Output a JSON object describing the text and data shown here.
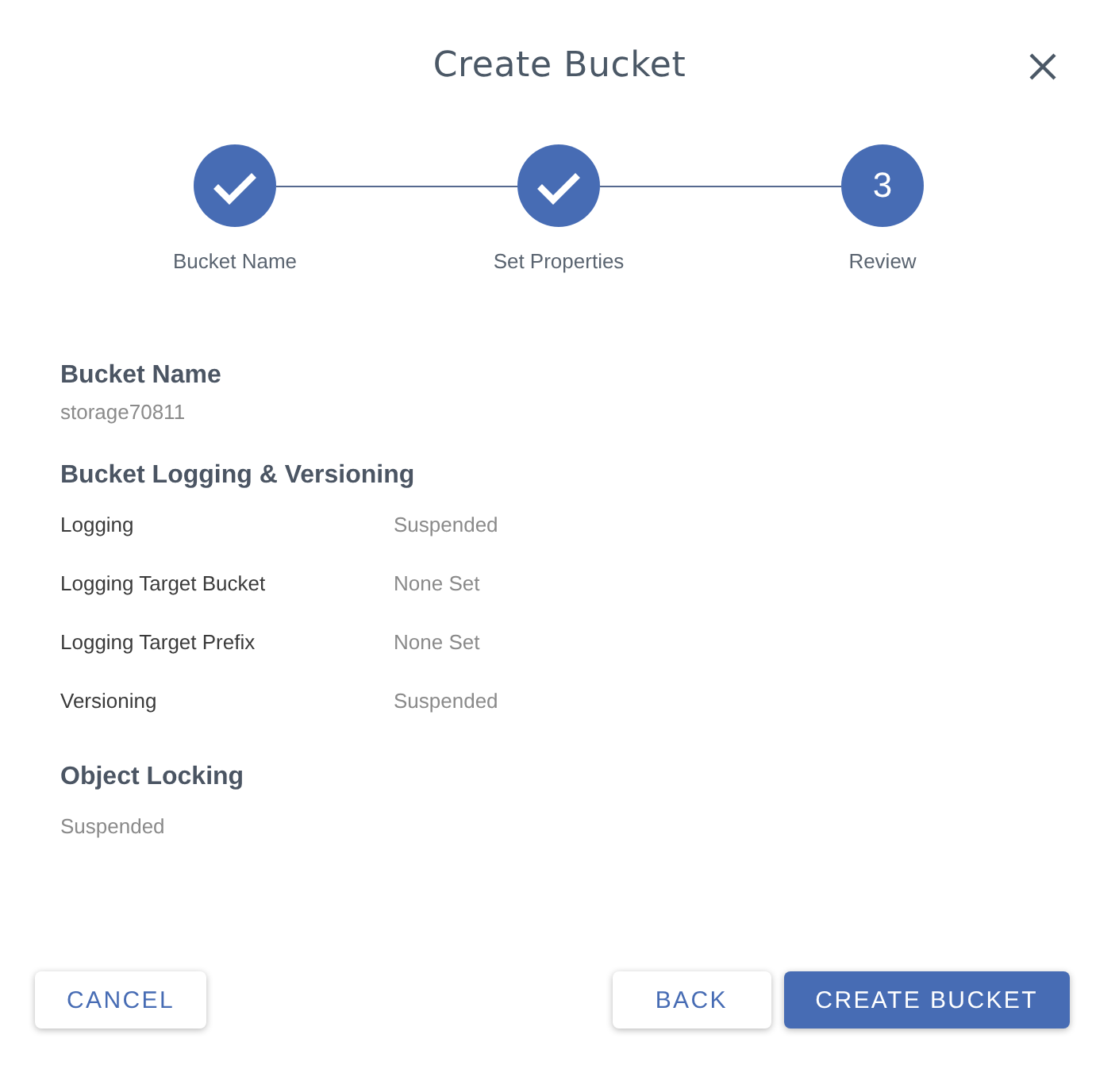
{
  "dialog": {
    "title": "Create Bucket"
  },
  "steps": [
    {
      "label": "Bucket Name",
      "kind": "completed"
    },
    {
      "label": "Set Properties",
      "kind": "completed"
    },
    {
      "label": "Review",
      "kind": "current",
      "number": "3"
    }
  ],
  "sections": [
    {
      "title": "Bucket Name",
      "kind": "value",
      "value": "storage70811"
    },
    {
      "title": "Bucket Logging & Versioning",
      "kind": "table",
      "rows": [
        {
          "label": "Logging",
          "value": "Suspended"
        },
        {
          "label": "Logging Target Bucket",
          "value": "None Set"
        },
        {
          "label": "Logging Target Prefix",
          "value": "None Set"
        },
        {
          "label": "Versioning",
          "value": "Suspended"
        }
      ]
    },
    {
      "title": "Object Locking",
      "kind": "value",
      "value": "Suspended"
    }
  ],
  "footer": {
    "left_buttons": [
      {
        "label": "CANCEL",
        "kind": "outlined"
      }
    ],
    "right_buttons": [
      {
        "label": "BACK",
        "kind": "outlined"
      },
      {
        "label": "CREATE BUCKET",
        "kind": "contained"
      }
    ]
  }
}
